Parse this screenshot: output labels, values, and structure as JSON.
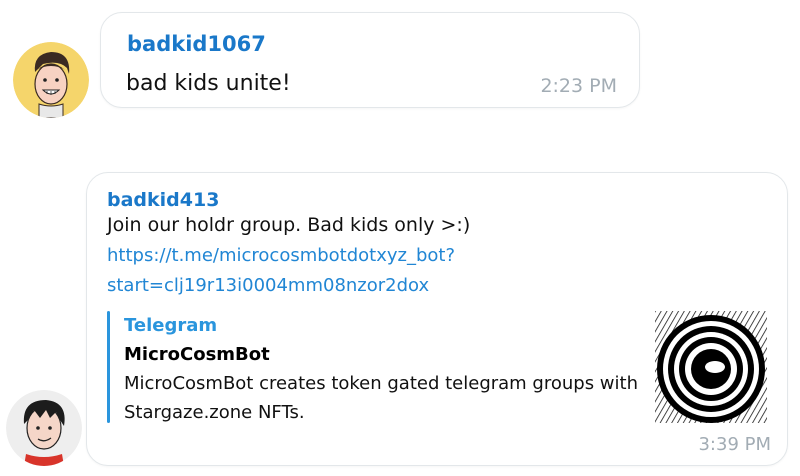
{
  "messages": [
    {
      "sender": "badkid1067",
      "text": "bad kids unite!",
      "time": "2:23 PM",
      "avatar": "cartoon-kid-avatar-yellow"
    },
    {
      "sender": "badkid413",
      "text": "Join our holdr group. Bad kids only >:)",
      "link_line1": "https://t.me/microcosmbotdotxyz_bot?",
      "link_line2": "start=clj19r13i0004mm08nzor2dox",
      "time": "3:39 PM",
      "avatar": "cartoon-kid-avatar-red",
      "preview": {
        "site": "Telegram",
        "title": "MicroCosmBot",
        "description": "MicroCosmBot creates token gated telegram groups with Stargaze.zone NFTs.",
        "thumbnail": "spiral-eye-logo"
      }
    }
  ],
  "colors": {
    "sender": "#1a78c9",
    "link": "#2186d4",
    "accent_bar": "#2a95dd",
    "time": "#a2acb4",
    "bubble_border": "#e3e7ea"
  }
}
